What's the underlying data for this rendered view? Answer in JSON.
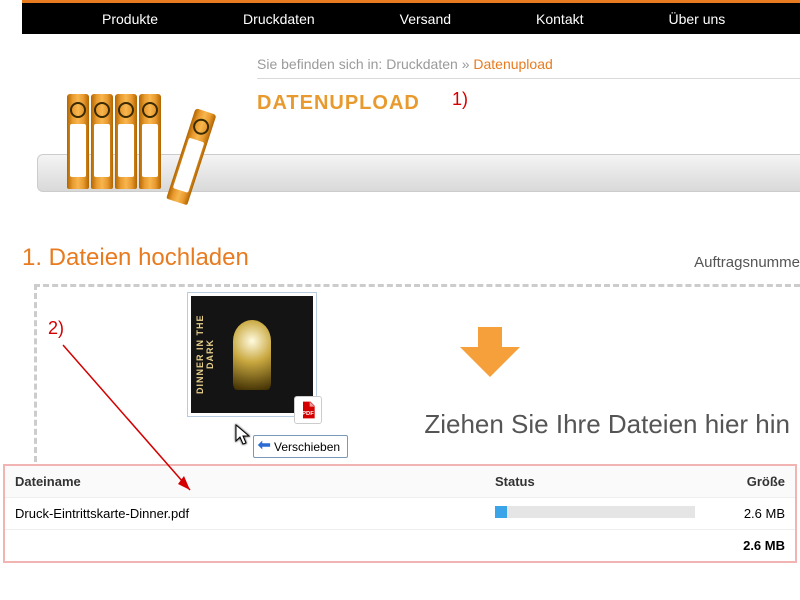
{
  "nav": {
    "items": [
      "Produkte",
      "Druckdaten",
      "Versand",
      "Kontakt",
      "Über uns"
    ]
  },
  "breadcrumb": {
    "prefix": "Sie befinden sich in:",
    "link": "Druckdaten",
    "sep": "»",
    "current": "Datenupload"
  },
  "page": {
    "title": "DATENUPLOAD"
  },
  "annotations": {
    "one": "1)",
    "two": "2)"
  },
  "upload": {
    "section_title": "1. Dateien hochladen",
    "ordernr_label": "Auftragsnumme",
    "drop_label": "Ziehen Sie Ihre Dateien hier hin",
    "tooltip": "Verschieben",
    "thumb_caption": "DINNER IN THE DARK"
  },
  "table": {
    "headers": {
      "name": "Dateiname",
      "status": "Status",
      "size": "Größe"
    },
    "rows": [
      {
        "name": "Druck-Eintrittskarte-Dinner.pdf",
        "progress_pct": 6,
        "size": "2.6 MB"
      }
    ],
    "total_size": "2.6 MB"
  }
}
